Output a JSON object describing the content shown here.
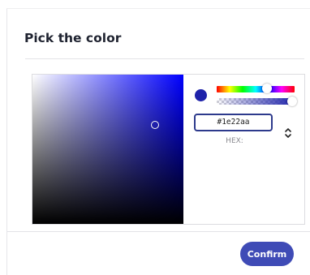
{
  "dialog": {
    "title": "Pick the color",
    "confirm_label": "Confirm"
  },
  "picker": {
    "hue_color": "#0000ff",
    "selected_hex": "#1e22aa",
    "hex_field_label": "HEX:",
    "hue_fraction": 0.65,
    "alpha_fraction": 1.0
  },
  "icons": {
    "format_toggle": "chevron-up-down-icon"
  },
  "colors": {
    "accent": "#3f4bb6",
    "input_border": "#2d3a8c",
    "swatch": "#1e22aa"
  }
}
